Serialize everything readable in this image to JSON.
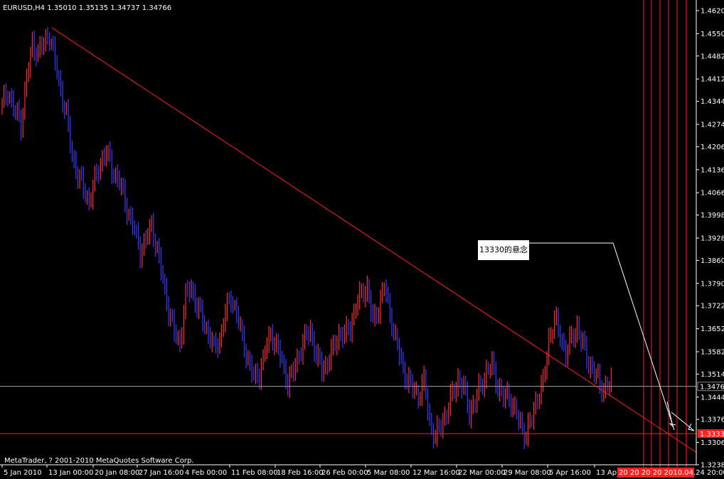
{
  "symbol_header": "EURUSD,H4  1.35010 1.35135 1.34737 1.34766",
  "copyright": "MetaTrader, ? 2001-2010 MetaQuotes Software Corp.",
  "annotation": "13330的悬念",
  "colors": {
    "background": "#000000",
    "up_bar": "#ff2d2d",
    "down_bar": "#3a3aff",
    "trendline": "#ff2020",
    "current_price_line": "#a0a0a0",
    "axis_text": "#ffffff"
  },
  "chart_data": {
    "type": "ohlc-bars",
    "ylim": [
      1.3238,
      1.462
    ],
    "price_ticks": [
      "1.46200",
      "1.45500",
      "1.44820",
      "1.44120",
      "1.43440",
      "1.42740",
      "1.42060",
      "1.41360",
      "1.40660",
      "1.39980",
      "1.39280",
      "1.38600",
      "1.37900",
      "1.37220",
      "1.36520",
      "1.35820",
      "1.35140",
      "1.34440",
      "1.33760",
      "1.33060",
      "1.32380"
    ],
    "time_ticks": [
      "5 Jan 2010",
      "13 Jan 00:00",
      "20 Jan 08:00",
      "27 Jan 16:00",
      "4 Feb 00:00",
      "11 Feb 08:00",
      "18 Feb 16:00",
      "26 Feb 00:00",
      "5 Mar 08:00",
      "12 Mar 16:00",
      "22 Mar 00:00",
      "29 Mar 08:00",
      "5 Apr 16:00",
      "13 Apr"
    ],
    "future_time_label": "20 20 20 20 2010.04.24 20:00",
    "current_price": "1.34766",
    "red_level_price": "1.33330",
    "close_path": [
      [
        0,
        1.433
      ],
      [
        3,
        1.438
      ],
      [
        6,
        1.432
      ],
      [
        10,
        1.428
      ],
      [
        13,
        1.441
      ],
      [
        16,
        1.452
      ],
      [
        19,
        1.449
      ],
      [
        22,
        1.452
      ],
      [
        25,
        1.455
      ],
      [
        28,
        1.446
      ],
      [
        31,
        1.438
      ],
      [
        34,
        1.43
      ],
      [
        37,
        1.418
      ],
      [
        40,
        1.412
      ],
      [
        43,
        1.408
      ],
      [
        46,
        1.404
      ],
      [
        49,
        1.41
      ],
      [
        52,
        1.416
      ],
      [
        55,
        1.419
      ],
      [
        58,
        1.414
      ],
      [
        61,
        1.411
      ],
      [
        64,
        1.406
      ],
      [
        67,
        1.4
      ],
      [
        70,
        1.395
      ],
      [
        73,
        1.389
      ],
      [
        76,
        1.392
      ],
      [
        79,
        1.397
      ],
      [
        82,
        1.389
      ],
      [
        85,
        1.38
      ],
      [
        88,
        1.371
      ],
      [
        91,
        1.364
      ],
      [
        94,
        1.361
      ],
      [
        97,
        1.375
      ],
      [
        100,
        1.378
      ],
      [
        103,
        1.372
      ],
      [
        106,
        1.368
      ],
      [
        109,
        1.364
      ],
      [
        112,
        1.359
      ],
      [
        115,
        1.362
      ],
      [
        118,
        1.37
      ],
      [
        121,
        1.375
      ],
      [
        124,
        1.37
      ],
      [
        127,
        1.362
      ],
      [
        130,
        1.356
      ],
      [
        133,
        1.35
      ],
      [
        136,
        1.352
      ],
      [
        139,
        1.358
      ],
      [
        142,
        1.364
      ],
      [
        145,
        1.36
      ],
      [
        148,
        1.355
      ],
      [
        151,
        1.349
      ],
      [
        154,
        1.352
      ],
      [
        157,
        1.358
      ],
      [
        160,
        1.362
      ],
      [
        163,
        1.365
      ],
      [
        166,
        1.357
      ],
      [
        169,
        1.353
      ],
      [
        172,
        1.355
      ],
      [
        175,
        1.359
      ],
      [
        178,
        1.364
      ],
      [
        181,
        1.363
      ],
      [
        184,
        1.366
      ],
      [
        187,
        1.372
      ],
      [
        190,
        1.376
      ],
      [
        193,
        1.378
      ],
      [
        196,
        1.367
      ],
      [
        199,
        1.372
      ],
      [
        202,
        1.378
      ],
      [
        205,
        1.37
      ],
      [
        208,
        1.362
      ],
      [
        211,
        1.355
      ],
      [
        214,
        1.35
      ],
      [
        217,
        1.347
      ],
      [
        220,
        1.345
      ],
      [
        223,
        1.349
      ],
      [
        226,
        1.337
      ],
      [
        229,
        1.332
      ],
      [
        232,
        1.336
      ],
      [
        235,
        1.34
      ],
      [
        238,
        1.345
      ],
      [
        241,
        1.35
      ],
      [
        244,
        1.347
      ],
      [
        247,
        1.34
      ],
      [
        250,
        1.343
      ],
      [
        253,
        1.348
      ],
      [
        256,
        1.352
      ],
      [
        259,
        1.354
      ],
      [
        262,
        1.348
      ],
      [
        265,
        1.344
      ],
      [
        268,
        1.345
      ],
      [
        271,
        1.34
      ],
      [
        274,
        1.336
      ],
      [
        277,
        1.333
      ],
      [
        280,
        1.338
      ],
      [
        283,
        1.345
      ],
      [
        286,
        1.348
      ],
      [
        289,
        1.362
      ],
      [
        292,
        1.368
      ],
      [
        295,
        1.363
      ],
      [
        298,
        1.358
      ],
      [
        301,
        1.362
      ],
      [
        304,
        1.366
      ],
      [
        307,
        1.36
      ],
      [
        310,
        1.355
      ],
      [
        313,
        1.352
      ],
      [
        316,
        1.348
      ],
      [
        319,
        1.347
      ],
      [
        322,
        1.349
      ]
    ]
  }
}
